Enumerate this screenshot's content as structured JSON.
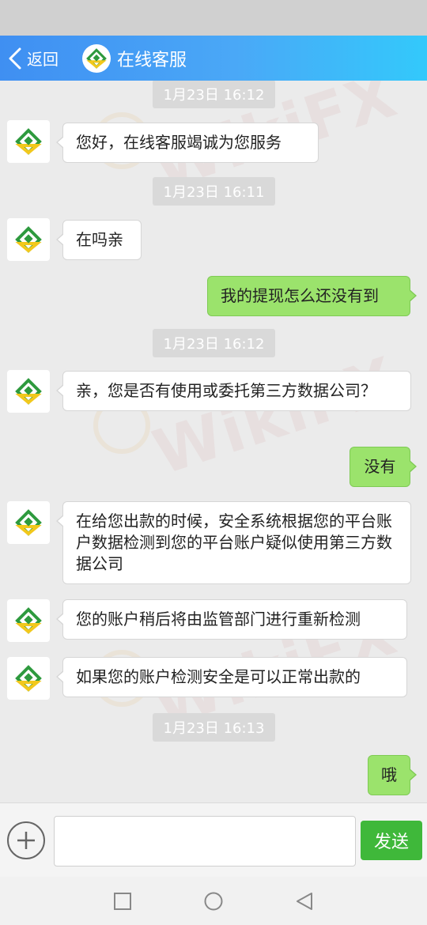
{
  "header": {
    "back_label": "返回",
    "title": "在线客服"
  },
  "colors": {
    "header_start": "#3f8ff2",
    "header_end": "#33c9fb",
    "outgoing_bubble": "#9be36c",
    "send_button": "#3fb83a",
    "logo_green": "#2e9a3e",
    "logo_yellow": "#f2c81c"
  },
  "watermark": "WikiFX",
  "messages": [
    {
      "type": "timestamp",
      "text": "1月23日 16:12"
    },
    {
      "type": "incoming",
      "text": "您好，在线客服竭诚为您服务"
    },
    {
      "type": "timestamp",
      "text": "1月23日 16:11"
    },
    {
      "type": "incoming",
      "text": "在吗亲"
    },
    {
      "type": "outgoing",
      "text": "我的提现怎么还没有到"
    },
    {
      "type": "timestamp",
      "text": "1月23日 16:12"
    },
    {
      "type": "incoming",
      "text": "亲，您是否有使用或委托第三方数据公司？"
    },
    {
      "type": "outgoing",
      "text": "没有"
    },
    {
      "type": "incoming",
      "text": "在给您出款的时候，安全系统根据您的平台账户数据检测到您的平台账户疑似使用第三方数据公司"
    },
    {
      "type": "incoming",
      "text": "您的账户稍后将由监管部门进行重新检测"
    },
    {
      "type": "incoming",
      "text": "如果您的账户检测安全是可以正常出款的"
    },
    {
      "type": "timestamp",
      "text": "1月23日 16:13"
    },
    {
      "type": "outgoing",
      "text": "哦"
    }
  ],
  "input": {
    "value": "",
    "placeholder": "",
    "send_label": "发送"
  },
  "navbar": {
    "icons": [
      "recent-apps-icon",
      "home-icon",
      "back-triangle-icon"
    ]
  }
}
